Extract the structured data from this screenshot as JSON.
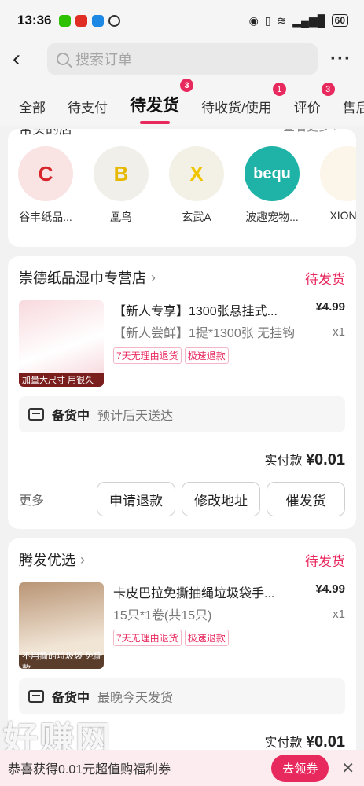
{
  "status_bar": {
    "time": "13:36",
    "battery": "60"
  },
  "header": {
    "search_placeholder": "搜索订单"
  },
  "tabs": [
    {
      "label": "全部",
      "badge": ""
    },
    {
      "label": "待支付",
      "badge": ""
    },
    {
      "label": "待发货",
      "badge": "3"
    },
    {
      "label": "待收货/使用",
      "badge": "1"
    },
    {
      "label": "评价",
      "badge": "3"
    },
    {
      "label": "售后",
      "badge": ""
    }
  ],
  "shops_section": {
    "title": "常买的店",
    "more": "查看更多 >",
    "shops": [
      {
        "name": "谷丰纸品...",
        "logo": "C"
      },
      {
        "name": "凰鸟",
        "logo": "B"
      },
      {
        "name": "玄武A",
        "logo": "X"
      },
      {
        "name": "波趣宠物...",
        "logo": "bequ"
      },
      {
        "name": "XIONG",
        "logo": ""
      }
    ]
  },
  "orders": [
    {
      "store": "崇德纸品湿巾专营店",
      "status": "待发货",
      "title": "【新人专享】1300张悬挂式...",
      "price": "¥4.99",
      "spec": "【新人尝鲜】1提*1300张 无挂钩",
      "qty": "x1",
      "tags": [
        "7天无理由退货",
        "极速退款"
      ],
      "thumb_caption": "加量大尺寸 用很久",
      "ship_status": "备货中",
      "ship_note": "预计后天送达",
      "total_label": "实付款",
      "total": "¥0.01",
      "more": "更多",
      "buttons": [
        "申请退款",
        "修改地址",
        "催发货"
      ]
    },
    {
      "store": "腾发优选",
      "status": "待发货",
      "title": "卡皮巴拉免撕抽绳垃圾袋手...",
      "price": "¥4.99",
      "spec": "15只*1卷(共15只)",
      "qty": "x1",
      "tags": [
        "7天无理由退货",
        "极速退款"
      ],
      "thumb_caption": "不用撕的垃圾袋 免撕款",
      "ship_status": "备货中",
      "ship_note": "最晚今天发货",
      "total_label": "实付款",
      "total": "¥0.01"
    }
  ],
  "banner": {
    "text": "恭喜获得0.01元超值购福利券",
    "button": "去领券"
  },
  "watermark": "好赚网",
  "colors": {
    "accent": "#e8295e"
  }
}
